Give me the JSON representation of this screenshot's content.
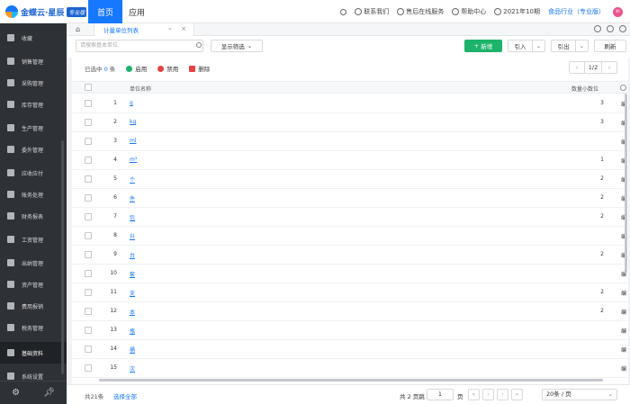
{
  "brand": {
    "name": "金蝶云·星辰",
    "badge": "专业版"
  },
  "nav": {
    "home": "首页",
    "app": "应用"
  },
  "top_right": {
    "contact": "联系我们",
    "service": "售后在线服务",
    "help": "帮助中心",
    "period": "2021年10期",
    "industry": "食品行业（专业版）",
    "avatar": "ki"
  },
  "sidebar": {
    "items": [
      {
        "label": "收藏",
        "icon": "star-icon"
      },
      {
        "label": "销售管理",
        "icon": "sales-icon"
      },
      {
        "label": "采购管理",
        "icon": "cart-icon"
      },
      {
        "label": "库存管理",
        "icon": "inventory-icon"
      },
      {
        "label": "生产管理",
        "icon": "tools-icon"
      },
      {
        "label": "委外管理",
        "icon": "outsource-icon"
      },
      {
        "label": "应收应付",
        "icon": "money-icon"
      },
      {
        "label": "账务处理",
        "icon": "ledger-icon"
      },
      {
        "label": "财务报表",
        "icon": "report-icon"
      },
      {
        "label": "工资管理",
        "icon": "salary-icon"
      },
      {
        "label": "出纳管理",
        "icon": "cashier-icon"
      },
      {
        "label": "资产管理",
        "icon": "asset-icon"
      },
      {
        "label": "费用报销",
        "icon": "expense-icon"
      },
      {
        "label": "税务管理",
        "icon": "tax-icon"
      },
      {
        "label": "基础资料",
        "icon": "layers-icon"
      },
      {
        "label": "系统设置",
        "icon": "gear-icon"
      }
    ],
    "active": "基础资料"
  },
  "tabs": {
    "current": "计量单位列表"
  },
  "toolbar": {
    "search_placeholder": "请搜索基本单位",
    "filter": "显示筛选",
    "new": "新增",
    "import": "引入",
    "export": "引出",
    "refresh": "刷新"
  },
  "selection": {
    "prefix": "已选中",
    "count": "0",
    "suffix": "条",
    "enable": "启用",
    "disable": "禁用",
    "delete": "删除",
    "page_indicator": "1/2"
  },
  "table": {
    "headers": {
      "name": "单位名称",
      "precision": "数量小数位"
    },
    "rows": [
      {
        "idx": "1",
        "name": "g",
        "precision": "3",
        "edit": "编"
      },
      {
        "idx": "2",
        "name": "kg",
        "precision": "3",
        "edit": "编"
      },
      {
        "idx": "3",
        "name": "ml",
        "precision": "",
        "edit": "编"
      },
      {
        "idx": "4",
        "name": "m³",
        "precision": "1",
        "edit": "编"
      },
      {
        "idx": "5",
        "name": "个",
        "precision": "2",
        "edit": "编"
      },
      {
        "idx": "6",
        "name": "件",
        "precision": "2",
        "edit": "编"
      },
      {
        "idx": "7",
        "name": "包",
        "precision": "2",
        "edit": "编"
      },
      {
        "idx": "8",
        "name": "升",
        "precision": "",
        "edit": "编"
      },
      {
        "idx": "9",
        "name": "台",
        "precision": "2",
        "edit": "编"
      },
      {
        "idx": "10",
        "name": "套",
        "precision": "",
        "edit": "编"
      },
      {
        "idx": "11",
        "name": "支",
        "precision": "2",
        "edit": "编"
      },
      {
        "idx": "12",
        "name": "本",
        "precision": "2",
        "edit": "编"
      },
      {
        "idx": "13",
        "name": "瓶",
        "precision": "",
        "edit": "编"
      },
      {
        "idx": "14",
        "name": "桶",
        "precision": "",
        "edit": "编"
      },
      {
        "idx": "15",
        "name": "次",
        "precision": "",
        "edit": "编"
      }
    ]
  },
  "footer": {
    "total": "共21条",
    "select_all": "选择全部",
    "pages": "共 2 页跳",
    "page_input": "1",
    "page_suffix": "页",
    "page_size": "20条 / 页"
  },
  "colors": {
    "primary": "#1677ff",
    "success": "#1db36b",
    "sidebar": "#2e3136"
  }
}
